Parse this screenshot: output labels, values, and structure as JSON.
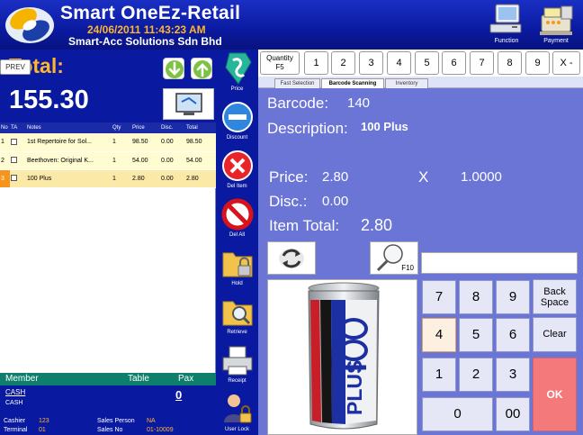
{
  "header": {
    "title": "Smart OneEz-Retail",
    "datetime": "24/06/2011 11:43:23 AM",
    "company": "Smart-Acc Solutions Sdn Bhd",
    "function_label": "Function",
    "payment_label": "Payment"
  },
  "left": {
    "prev_label": "PREV",
    "total_label": "Total:",
    "total_value": "155.30",
    "columns": [
      "No",
      "TA",
      "Notes",
      "Qty",
      "Price",
      "Disc.",
      "Total"
    ],
    "items": [
      {
        "no": "1",
        "notes": "1st Repertoire for Sol...",
        "qty": "1",
        "price": "98.50",
        "disc": "0.00",
        "total": "98.50"
      },
      {
        "no": "2",
        "notes": "Beethoven: Original K...",
        "qty": "1",
        "price": "54.00",
        "disc": "0.00",
        "total": "54.00"
      },
      {
        "no": "3",
        "notes": "100 Plus",
        "qty": "1",
        "price": "2.80",
        "disc": "0.00",
        "total": "2.80"
      }
    ],
    "member_label": "Member",
    "table_label": "Table",
    "pax_label": "Pax",
    "member_code": "CASH",
    "member_name": "CASH",
    "pax_value": "0",
    "cashier_label": "Cashier",
    "cashier_value": "123",
    "terminal_label": "Terminal",
    "terminal_value": "01",
    "salesperson_label": "Sales Person",
    "salesperson_value": "NA",
    "salesno_label": "Sales  No",
    "salesno_value": "01-10009"
  },
  "functions": {
    "price": "Price",
    "discount": "Discount",
    "del_item": "Del Item",
    "del_all": "Del All",
    "hold": "Hold",
    "retrieve": "Retrieve",
    "receipt": "Receipt",
    "user_lock": "User Lock"
  },
  "qty_bar": {
    "label": "Quantity",
    "key": "F5",
    "numbers": [
      "1",
      "2",
      "3",
      "4",
      "5",
      "6",
      "7",
      "8",
      "9"
    ],
    "clear": "X -"
  },
  "tabs": [
    "Fast Selection",
    "Barcode Scanning",
    "Inventory"
  ],
  "details": {
    "barcode_label": "Barcode:",
    "barcode_value": "140",
    "description_label": "Description:",
    "description_value": "100 Plus",
    "price_label": "Price:",
    "price_value": "2.80",
    "x_label": "X",
    "qty_value": "1.0000",
    "disc_label": "Disc.:",
    "disc_value": "0.00",
    "item_total_label": "Item Total:",
    "item_total_value": "2.80"
  },
  "search": {
    "key": "F10"
  },
  "product_image_text": "100 PLUS",
  "numpad": {
    "seven": "7",
    "eight": "8",
    "nine": "9",
    "four": "4",
    "five": "5",
    "six": "6",
    "one": "1",
    "two": "2",
    "three": "3",
    "zero": "0",
    "double_zero": "00",
    "backspace": "Back Space",
    "clear": "Clear",
    "ok": "OK"
  }
}
